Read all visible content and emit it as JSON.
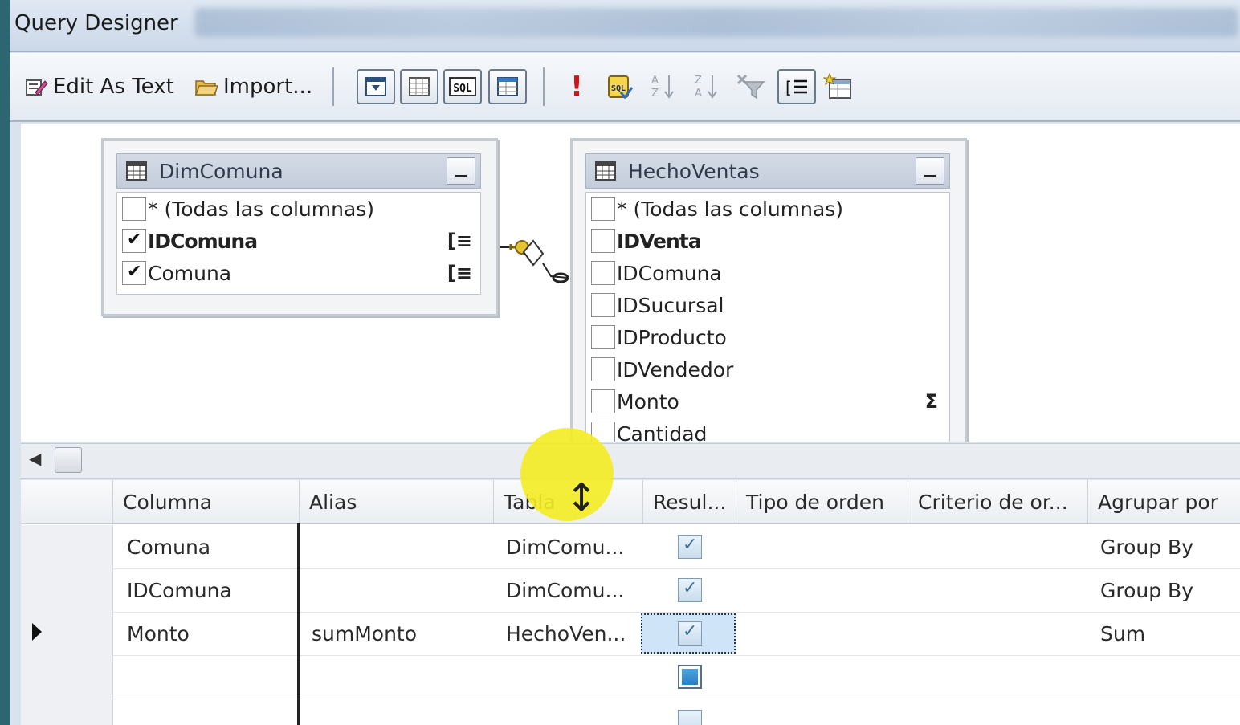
{
  "window": {
    "title": "Query Designer"
  },
  "toolbar": {
    "edit_as_text": "Edit As Text",
    "import": "Import..."
  },
  "diagram": {
    "tables": [
      {
        "name": "DimComuna",
        "columns": [
          {
            "label": "* (Todas las columnas)",
            "checked": false,
            "bold": false,
            "marker": ""
          },
          {
            "label": "IDComuna",
            "checked": true,
            "bold": true,
            "marker": "[≡"
          },
          {
            "label": "Comuna",
            "checked": true,
            "bold": false,
            "marker": "[≡"
          }
        ]
      },
      {
        "name": "HechoVentas",
        "columns": [
          {
            "label": "* (Todas las columnas)",
            "checked": false,
            "bold": false,
            "marker": ""
          },
          {
            "label": "IDVenta",
            "checked": false,
            "bold": true,
            "marker": ""
          },
          {
            "label": "IDComuna",
            "checked": false,
            "bold": false,
            "marker": ""
          },
          {
            "label": "IDSucursal",
            "checked": false,
            "bold": false,
            "marker": ""
          },
          {
            "label": "IDProducto",
            "checked": false,
            "bold": false,
            "marker": ""
          },
          {
            "label": "IDVendedor",
            "checked": false,
            "bold": false,
            "marker": ""
          },
          {
            "label": "Monto",
            "checked": false,
            "bold": false,
            "marker": "Σ"
          },
          {
            "label": "Cantidad",
            "checked": false,
            "bold": false,
            "marker": ""
          }
        ]
      }
    ]
  },
  "grid": {
    "headers": [
      "Columna",
      "Alias",
      "Tabla",
      "Resul...",
      "Tipo de orden",
      "Criterio de or...",
      "Agrupar por"
    ],
    "rows": [
      {
        "columna": "Comuna",
        "alias": "",
        "tabla": "DimComu...",
        "resultado": true,
        "tipo_orden": "",
        "criterio": "",
        "agrupar": "Group By"
      },
      {
        "columna": "IDComuna",
        "alias": "",
        "tabla": "DimComu...",
        "resultado": true,
        "tipo_orden": "",
        "criterio": "",
        "agrupar": "Group By"
      },
      {
        "columna": "Monto",
        "alias": "sumMonto",
        "tabla": "HechoVen...",
        "resultado": true,
        "tipo_orden": "",
        "criterio": "",
        "agrupar": "Sum"
      },
      {
        "columna": "",
        "alias": "",
        "tabla": "",
        "resultado": null,
        "tipo_orden": "",
        "criterio": "",
        "agrupar": ""
      }
    ]
  }
}
